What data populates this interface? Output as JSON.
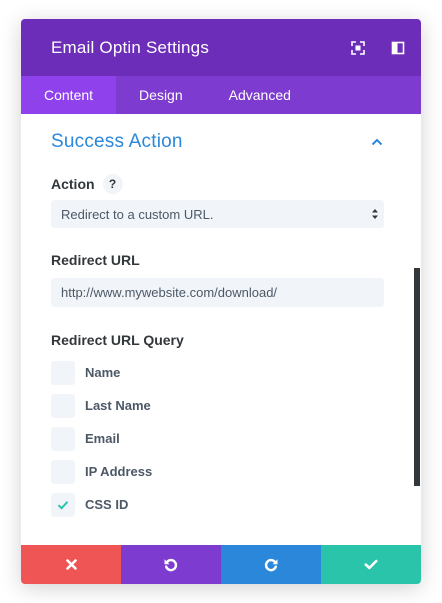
{
  "header": {
    "title": "Email Optin Settings",
    "expand_icon": "expand-icon",
    "sidebar_icon": "dock-sidebar-icon",
    "color": "#6c2eb9"
  },
  "tabs": [
    {
      "label": "Content",
      "active": true
    },
    {
      "label": "Design",
      "active": false
    },
    {
      "label": "Advanced",
      "active": false
    }
  ],
  "section": {
    "title": "Success Action",
    "toggle_icon": "chevron-up-icon",
    "title_color": "#2b87da"
  },
  "action": {
    "label": "Action",
    "help": "?",
    "value": "Redirect to a custom URL."
  },
  "redirect_url": {
    "label": "Redirect URL",
    "value": "http://www.mywebsite.com/download/"
  },
  "query": {
    "label": "Redirect URL Query",
    "options": [
      {
        "label": "Name",
        "checked": false
      },
      {
        "label": "Last Name",
        "checked": false
      },
      {
        "label": "Email",
        "checked": false
      },
      {
        "label": "IP Address",
        "checked": false
      },
      {
        "label": "CSS ID",
        "checked": true
      }
    ],
    "check_color": "#29c4a9"
  },
  "footer": {
    "buttons": [
      {
        "name": "cancel",
        "icon": "close-icon",
        "color": "#ef5555"
      },
      {
        "name": "undo",
        "icon": "undo-icon",
        "color": "#7e3bd0"
      },
      {
        "name": "redo",
        "icon": "redo-icon",
        "color": "#2b87da"
      },
      {
        "name": "save",
        "icon": "checkmark-icon",
        "color": "#29c4a9"
      }
    ]
  }
}
